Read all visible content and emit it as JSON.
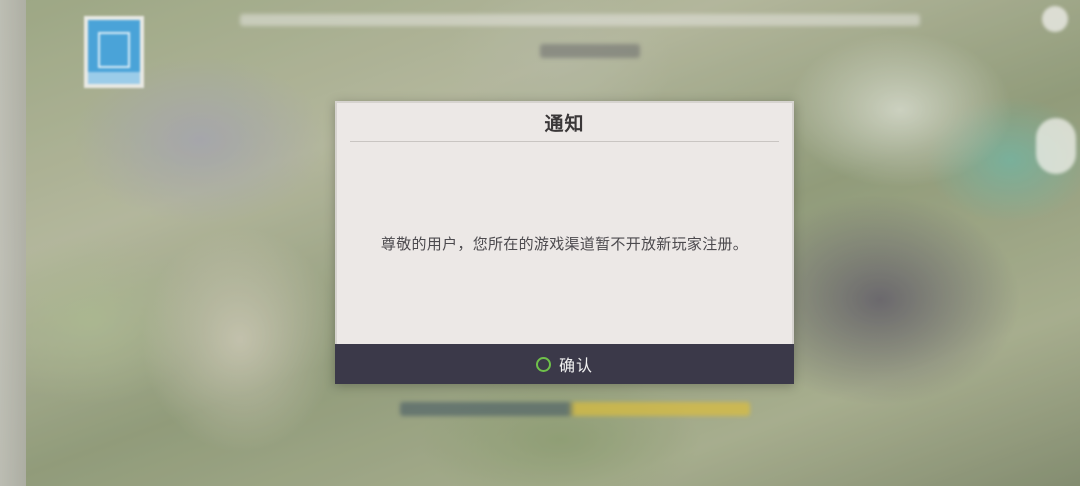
{
  "dialog": {
    "title": "通知",
    "message": "尊敬的用户，您所在的游戏渠道暂不开放新玩家注册。",
    "confirm_label": "确认",
    "confirm_icon": "circle-ring-icon"
  },
  "colors": {
    "dialog_background": "#ece8e6",
    "confirm_bar": "#3b3949",
    "confirm_icon": "#6fc14a"
  }
}
